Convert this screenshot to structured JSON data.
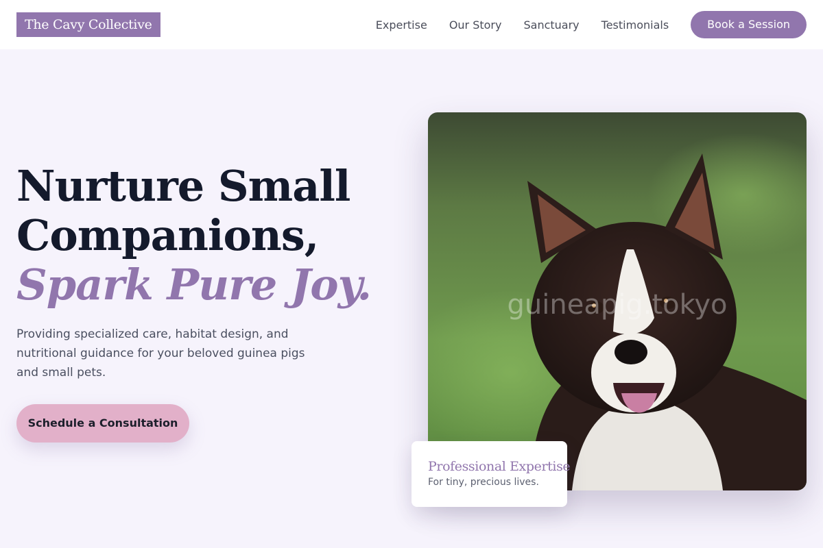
{
  "nav": {
    "logo": "The Cavy Collective",
    "links": [
      "Expertise",
      "Our Story",
      "Sanctuary",
      "Testimonials"
    ],
    "cta": "Book a Session"
  },
  "hero": {
    "headline_line1": "Nurture Small",
    "headline_line2": "Companions,",
    "headline_accent": "Spark Pure Joy.",
    "subtext": "Providing specialized care, habitat design, and nutritional guidance for your beloved guinea pigs and small pets.",
    "cta": "Schedule a Consultation"
  },
  "image": {
    "watermark": "guineapig.tokyo",
    "subject": "dog-photo"
  },
  "card": {
    "title": "Professional Expertise",
    "subtitle": "For tiny, precious lives."
  },
  "colors": {
    "accent": "#9176ad",
    "cta_pink": "#e2b0c9",
    "background": "#f6f3fc",
    "headline": "#141a2c"
  }
}
